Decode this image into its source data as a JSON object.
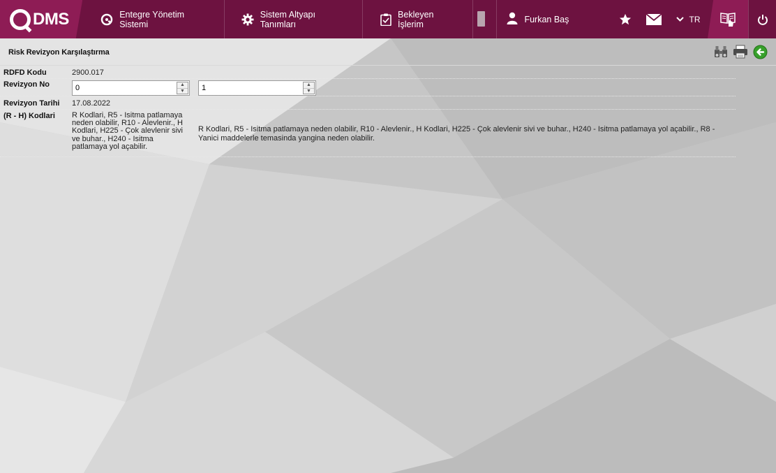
{
  "brand": {
    "logo_text": "DMS",
    "accent": "#6d1240",
    "accent_light": "#8e1c55"
  },
  "nav": [
    {
      "label": "Entegre Yönetim Sistemi",
      "icon": "qdms-circle-icon"
    },
    {
      "label": "Sistem Altyapı Tanımları",
      "icon": "gear-icon"
    },
    {
      "label": "Bekleyen İşlerim",
      "icon": "clipboard-check-icon"
    }
  ],
  "user": {
    "name": "Furkan Baş"
  },
  "lang": "TR",
  "page": {
    "title": "Risk Revizyon Karşılaştırma"
  },
  "fields": {
    "rdfd_kodu": {
      "label": "RDFD Kodu",
      "value": "2900.017"
    },
    "revizyon_no": {
      "label": "Revizyon No",
      "left_value": "0",
      "right_value": "1"
    },
    "revizyon_tarihi": {
      "label": "Revizyon Tarihi",
      "value": "17.08.2022"
    },
    "rh_kodlari": {
      "label": "(R - H) Kodlari",
      "left_value": "R Kodlari, R5 - Isitma patlamaya neden olabilir, R10 - Alevlenir., H Kodlari, H225 - Çok alevlenir sivi ve buhar., H240 - Isitma patlamaya yol açabilir.",
      "right_value": "R Kodlari, R5 - Isitma patlamaya neden olabilir, R10 - Alevlenir., H Kodlari, H225 - Çok alevlenir sivi ve buhar., H240 - Isitma patlamaya yol açabilir., R8 - Yanici maddelerle temasinda yangina neden olabilir."
    }
  }
}
